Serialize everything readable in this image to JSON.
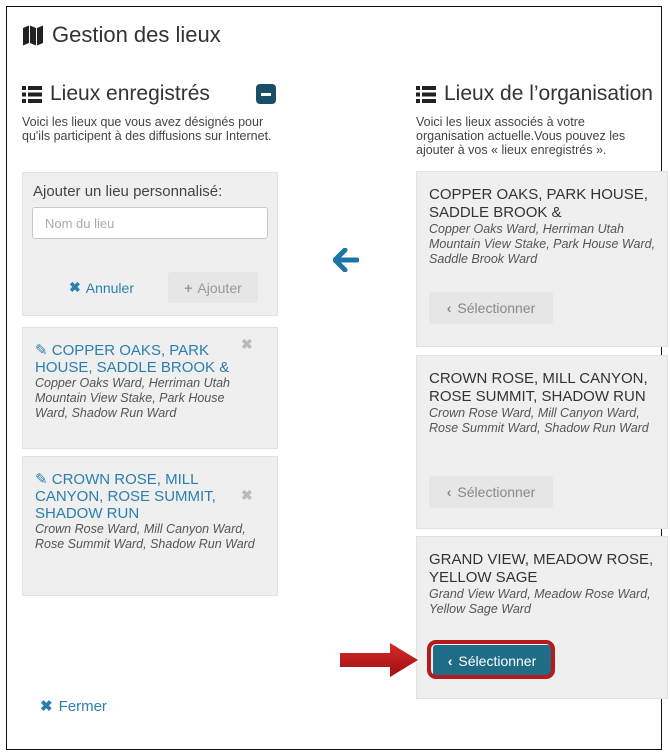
{
  "title": "Gestion des lieux",
  "left": {
    "heading": "Lieux enregistrés",
    "description": "Voici les lieux que vous avez désignés pour qu'ils participent à des diffusions sur Internet.",
    "add_label": "Ajouter un lieu personnalisé:",
    "input": {
      "placeholder": "Nom du lieu",
      "value": ""
    },
    "cancel_label": "Annuler",
    "add_button_label": "Ajouter",
    "cards": [
      {
        "title": "COPPER OAKS, PARK HOUSE, SADDLE BROOK &",
        "subtitle": "Copper Oaks Ward, Herriman Utah Mountain View Stake, Park House Ward, Shadow Run Ward"
      },
      {
        "title": "CROWN ROSE, MILL CANYON, ROSE SUMMIT, SHADOW RUN",
        "subtitle": "Crown Rose Ward, Mill Canyon Ward, Rose Summit Ward, Shadow Run Ward"
      }
    ]
  },
  "right": {
    "heading": "Lieux de l’organisation",
    "description": "Voici les lieux associés à votre organisation actuelle.Vous pouvez les ajouter à vos « lieux enregistrés ».",
    "cards": [
      {
        "title": "COPPER OAKS, PARK HOUSE, SADDLE BROOK &",
        "subtitle": "Copper Oaks Ward, Herriman Utah Mountain View Stake, Park House Ward, Saddle Brook Ward",
        "button": "Sélectionner"
      },
      {
        "title": "CROWN ROSE, MILL CANYON, ROSE SUMMIT, SHADOW RUN",
        "subtitle": "Crown Rose Ward, Mill Canyon Ward, Rose Summit Ward, Shadow Run Ward",
        "button": "Sélectionner"
      },
      {
        "title": "GRAND VIEW, MEADOW ROSE, YELLOW SAGE",
        "subtitle": "Grand View Ward, Meadow Rose Ward, Yellow Sage Ward",
        "button": "Sélectionner"
      }
    ]
  },
  "close_label": "Fermer",
  "colors": {
    "accent": "#2a80b0",
    "active_button": "#1e6c86",
    "highlight": "#b51b1b",
    "panel": "#efefef"
  }
}
